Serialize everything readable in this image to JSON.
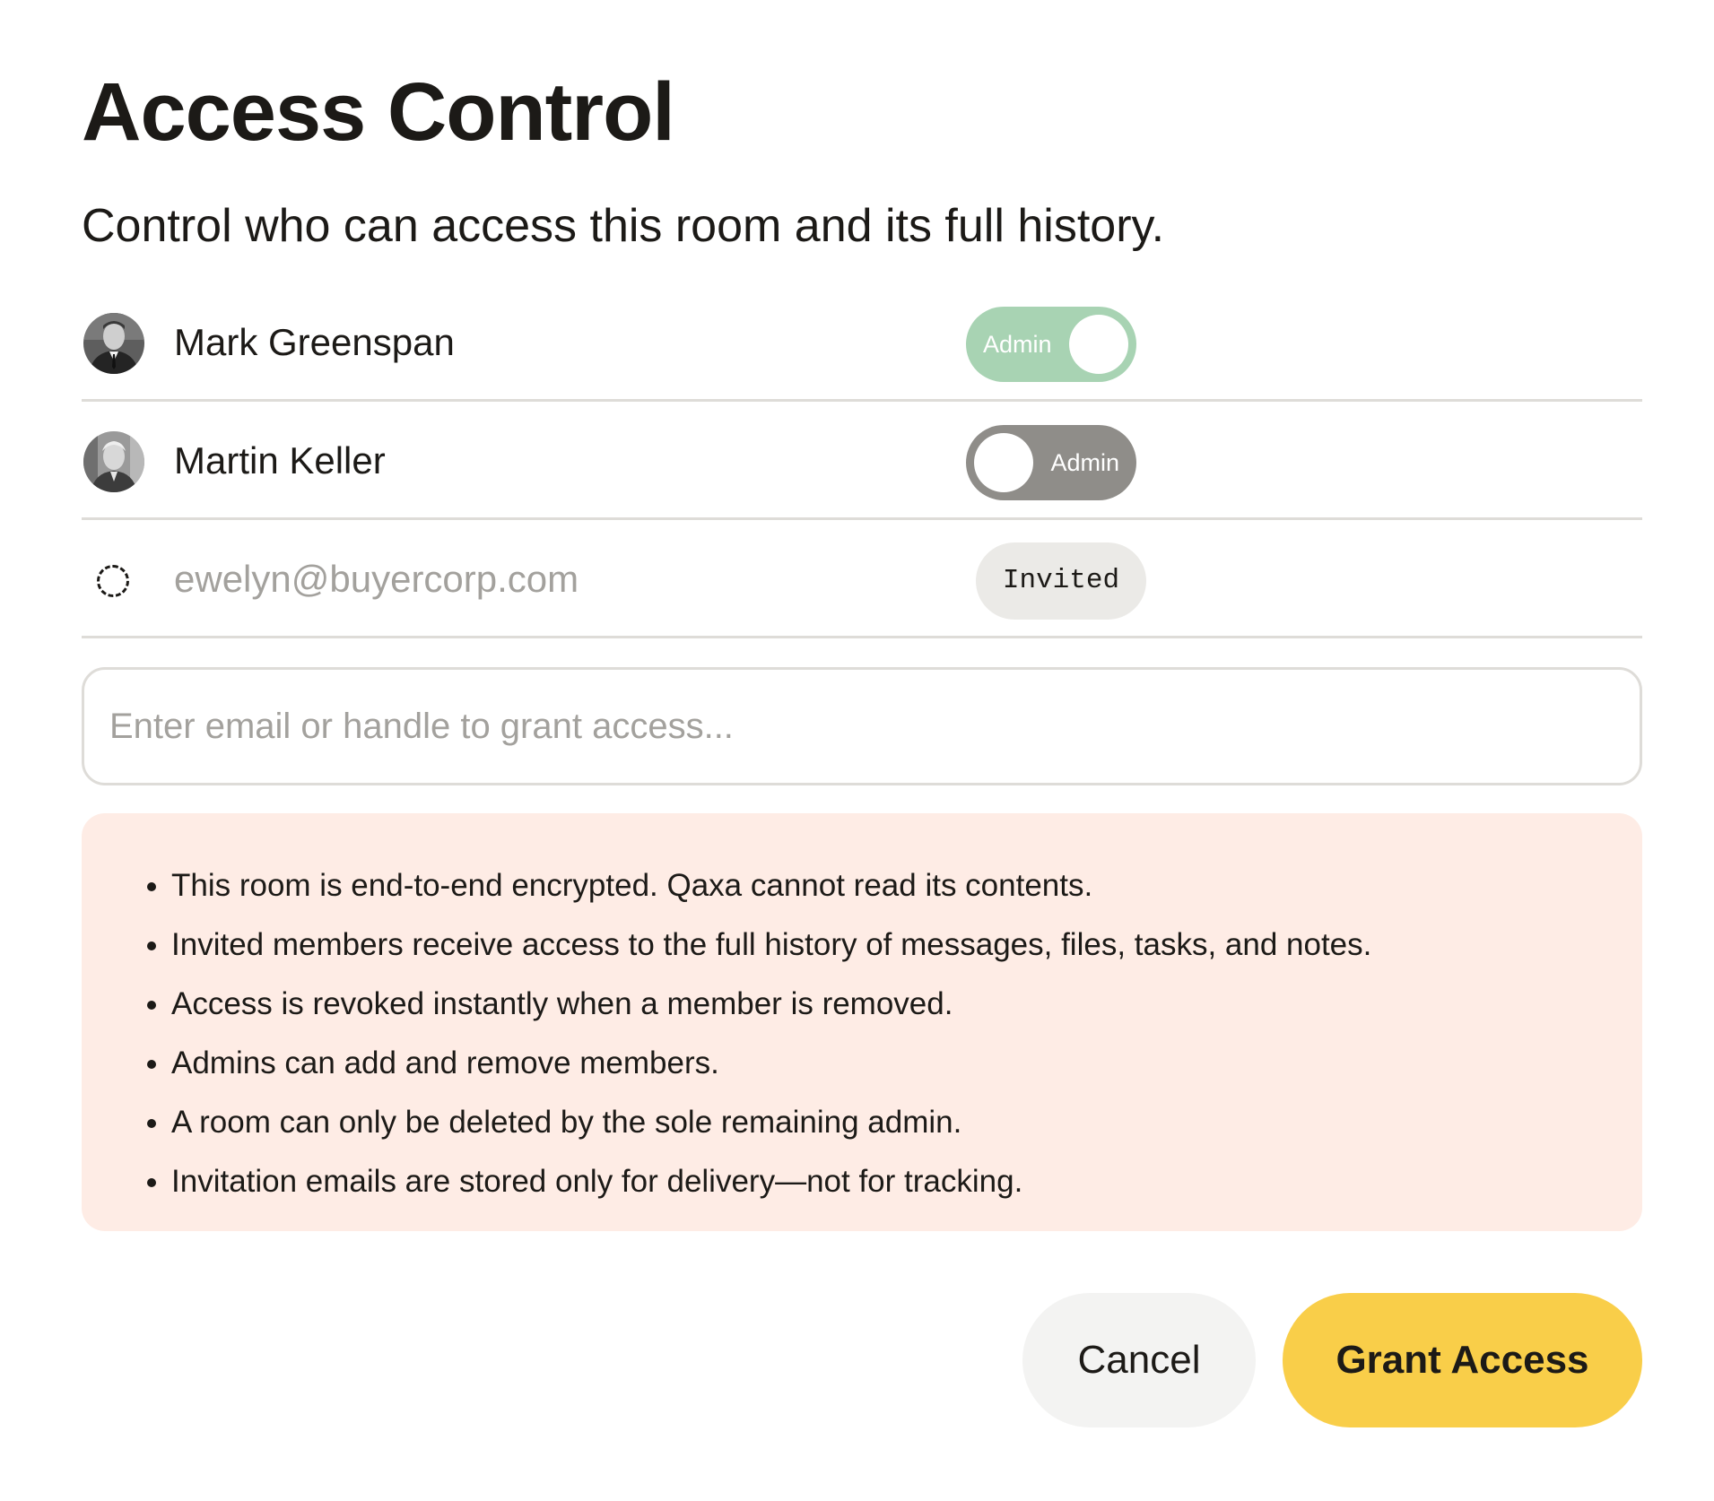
{
  "dialog": {
    "title": "Access Control",
    "subtitle": "Control who can access this room and its full history."
  },
  "members": [
    {
      "name": "Mark Greenspan",
      "role_label": "Admin",
      "admin": true
    },
    {
      "name": "Martin Keller",
      "role_label": "Admin",
      "admin": false
    },
    {
      "name": "ewelyn@buyercorp.com",
      "status": "Invited"
    }
  ],
  "grant_input": {
    "placeholder": "Enter email or handle to grant access...",
    "value": ""
  },
  "notice": {
    "items": [
      "This room is end-to-end encrypted. Qaxa cannot read its contents.",
      "Invited members receive access to the full history of messages, files, tasks, and notes.",
      "Access is revoked instantly when a member is removed.",
      "Admins can add and remove members.",
      "A room can only be deleted by the sole remaining admin.",
      "Invitation emails are stored only for delivery—not for tracking."
    ]
  },
  "actions": {
    "cancel_label": "Cancel",
    "grant_label": "Grant Access"
  },
  "colors": {
    "toggle_on": "#a8d3b3",
    "toggle_off": "#8f8d89",
    "notice_bg": "#feece5",
    "primary_button": "#f9ce49",
    "secondary_button": "#f3f3f2"
  }
}
